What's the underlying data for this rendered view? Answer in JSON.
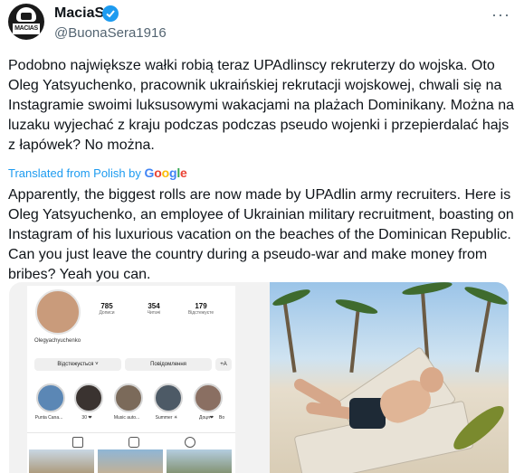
{
  "author": {
    "name": "MaciaS",
    "handle": "@BuonaSera1916",
    "avatar_text": "MACIAS"
  },
  "menu_icon": "more-horizontal-icon",
  "original_text": "Podobno największe wałki robią teraz UPAdlinscy rekruterzy do wojska. Oto Oleg Yatsyuchenko, pracownik ukraińskiej rekrutacji wojskowej, chwali się na Instagramie swoimi luksusowymi wakacjami na plażach Dominikany. Można na luzaku wyjechać z kraju podczas podczas pseudo wojenki i przepierdalać hajs z łapówek? No można.",
  "translation": {
    "label": "Translated from Polish by",
    "provider": "Google",
    "text": "Apparently, the biggest rolls are now made by UPAdlin army recruiters. Here is Oleg Yatsyuchenko, an employee of Ukrainian military recruitment, boasting on Instagram of his luxurious vacation on the beaches of the Dominican Republic. Can you just leave the country during a pseudo-war and make money from bribes? Yeah you can."
  },
  "instagram": {
    "username": "Olegyachyuchenko",
    "stats": [
      {
        "value": "785",
        "label": "Дописи"
      },
      {
        "value": "354",
        "label": "Читачі"
      },
      {
        "value": "179",
        "label": "Відстежуєте"
      }
    ],
    "follow_btn": "Відстежується ˅",
    "message_btn": "Повідомлення",
    "add_btn": "+A",
    "highlights": [
      "Punta Cana...",
      "30 ❤",
      "Music auto...",
      "Summer ☀",
      "Доця❤",
      "Bo"
    ]
  },
  "colors": {
    "accent": "#1d9bf0",
    "text": "#0f1419",
    "muted": "#536471"
  }
}
